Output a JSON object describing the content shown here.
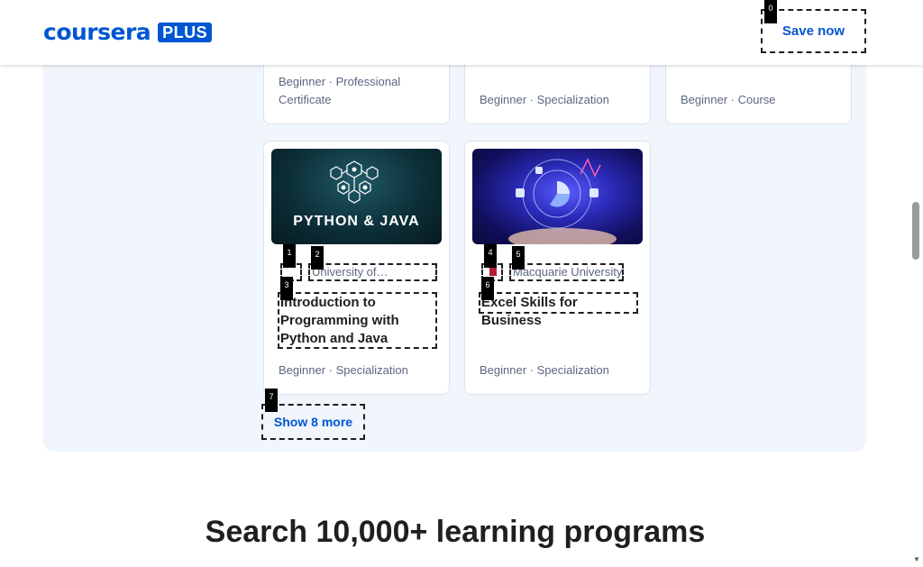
{
  "header": {
    "logo_text": "coursera",
    "logo_badge": "PLUS",
    "save_button": "Save now"
  },
  "top_cards": [
    {
      "meta": "Beginner · Professional Certificate"
    },
    {
      "meta": "Beginner · Specialization"
    },
    {
      "meta": "Beginner · Course"
    }
  ],
  "cards": [
    {
      "thumb_text": "PYTHON & JAVA",
      "partner": "University of…",
      "title": "Introduction to Programming with Python and Java",
      "meta": "Beginner · Specialization"
    },
    {
      "partner": "Macquarie University",
      "title": "Excel Skills for Business",
      "meta": "Beginner · Specialization"
    }
  ],
  "show_more": "Show 8 more",
  "search_heading": "Search 10,000+ learning programs",
  "tags": [
    "0",
    "1",
    "2",
    "3",
    "4",
    "5",
    "6",
    "7"
  ],
  "colors": {
    "accent": "#0056d2",
    "panel": "#f0f6fc"
  }
}
